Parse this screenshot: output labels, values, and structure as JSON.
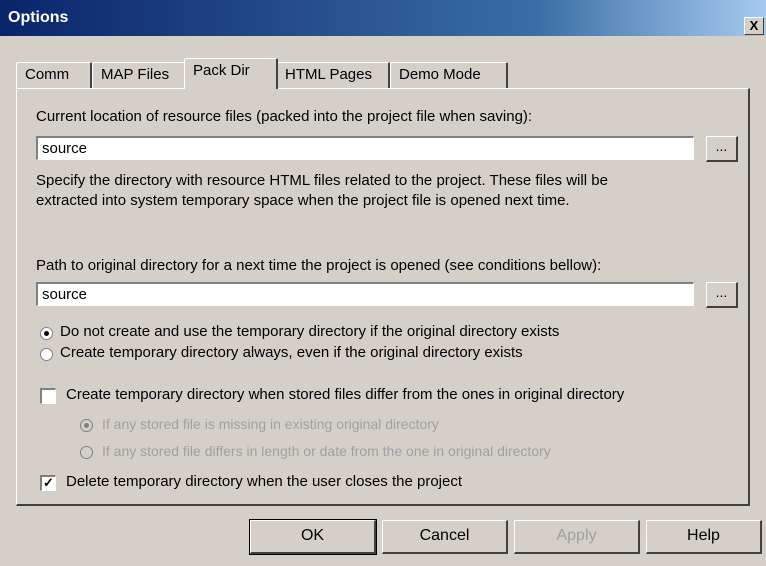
{
  "window": {
    "title": "Options",
    "close_label": "X"
  },
  "tabs": [
    {
      "label": "Comm"
    },
    {
      "label": "MAP Files"
    },
    {
      "label": "Pack Dir"
    },
    {
      "label": "HTML Pages"
    },
    {
      "label": "Demo Mode"
    }
  ],
  "pack_dir": {
    "current_location_label": "Current location of resource files (packed into the project file when saving):",
    "current_location_value": "source",
    "description_line1": "Specify the directory with resource HTML files related to the project. These files will be",
    "description_line2": "extracted into system temporary space when the project file is opened next time.",
    "original_path_label": "Path to original directory for a next time the project is opened (see conditions bellow):",
    "original_path_value": "source",
    "browse_label": "...",
    "radio_no_temp": "Do not create and use the temporary directory if the original directory exists",
    "radio_always_temp": "Create temporary directory always, even if the original directory exists",
    "check_differ": "Create temporary directory when stored files differ from the ones in original directory",
    "sub_radio_missing": "If any stored file is missing in existing original directory",
    "sub_radio_length": "If any stored file differs in length or date from the one in original directory",
    "check_delete": "Delete temporary directory when the user closes the project"
  },
  "buttons": {
    "ok": "OK",
    "cancel": "Cancel",
    "apply": "Apply",
    "help": "Help"
  }
}
